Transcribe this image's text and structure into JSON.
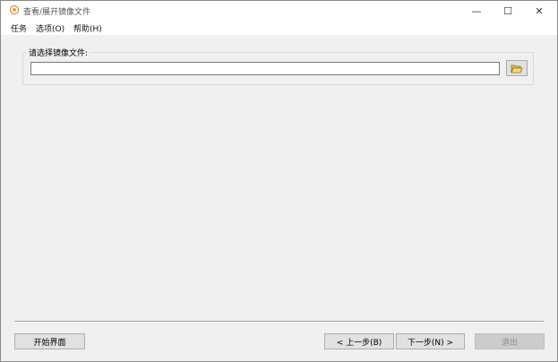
{
  "window": {
    "title": "查看/展开镜像文件",
    "controls": {
      "minimize": "—",
      "maximize": "☐",
      "close": "✕"
    }
  },
  "menu": {
    "items": [
      "任务",
      "选项(O)",
      "帮助(H)"
    ]
  },
  "form": {
    "group_label": "请选择镜像文件:",
    "path_value": "",
    "browse_icon": "folder-open-icon"
  },
  "footer": {
    "start_label": "开始界面",
    "prev_label": "< 上一步(B)",
    "next_label": "下一步(N) >",
    "exit_label": "退出",
    "exit_enabled": false
  },
  "colors": {
    "titlebar_bg": "#ffffff",
    "window_bg": "#f0f0f0",
    "button_bg": "#e1e1e1",
    "disabled_button_bg": "#cccccc",
    "folder_icon": "#e7c15a"
  }
}
